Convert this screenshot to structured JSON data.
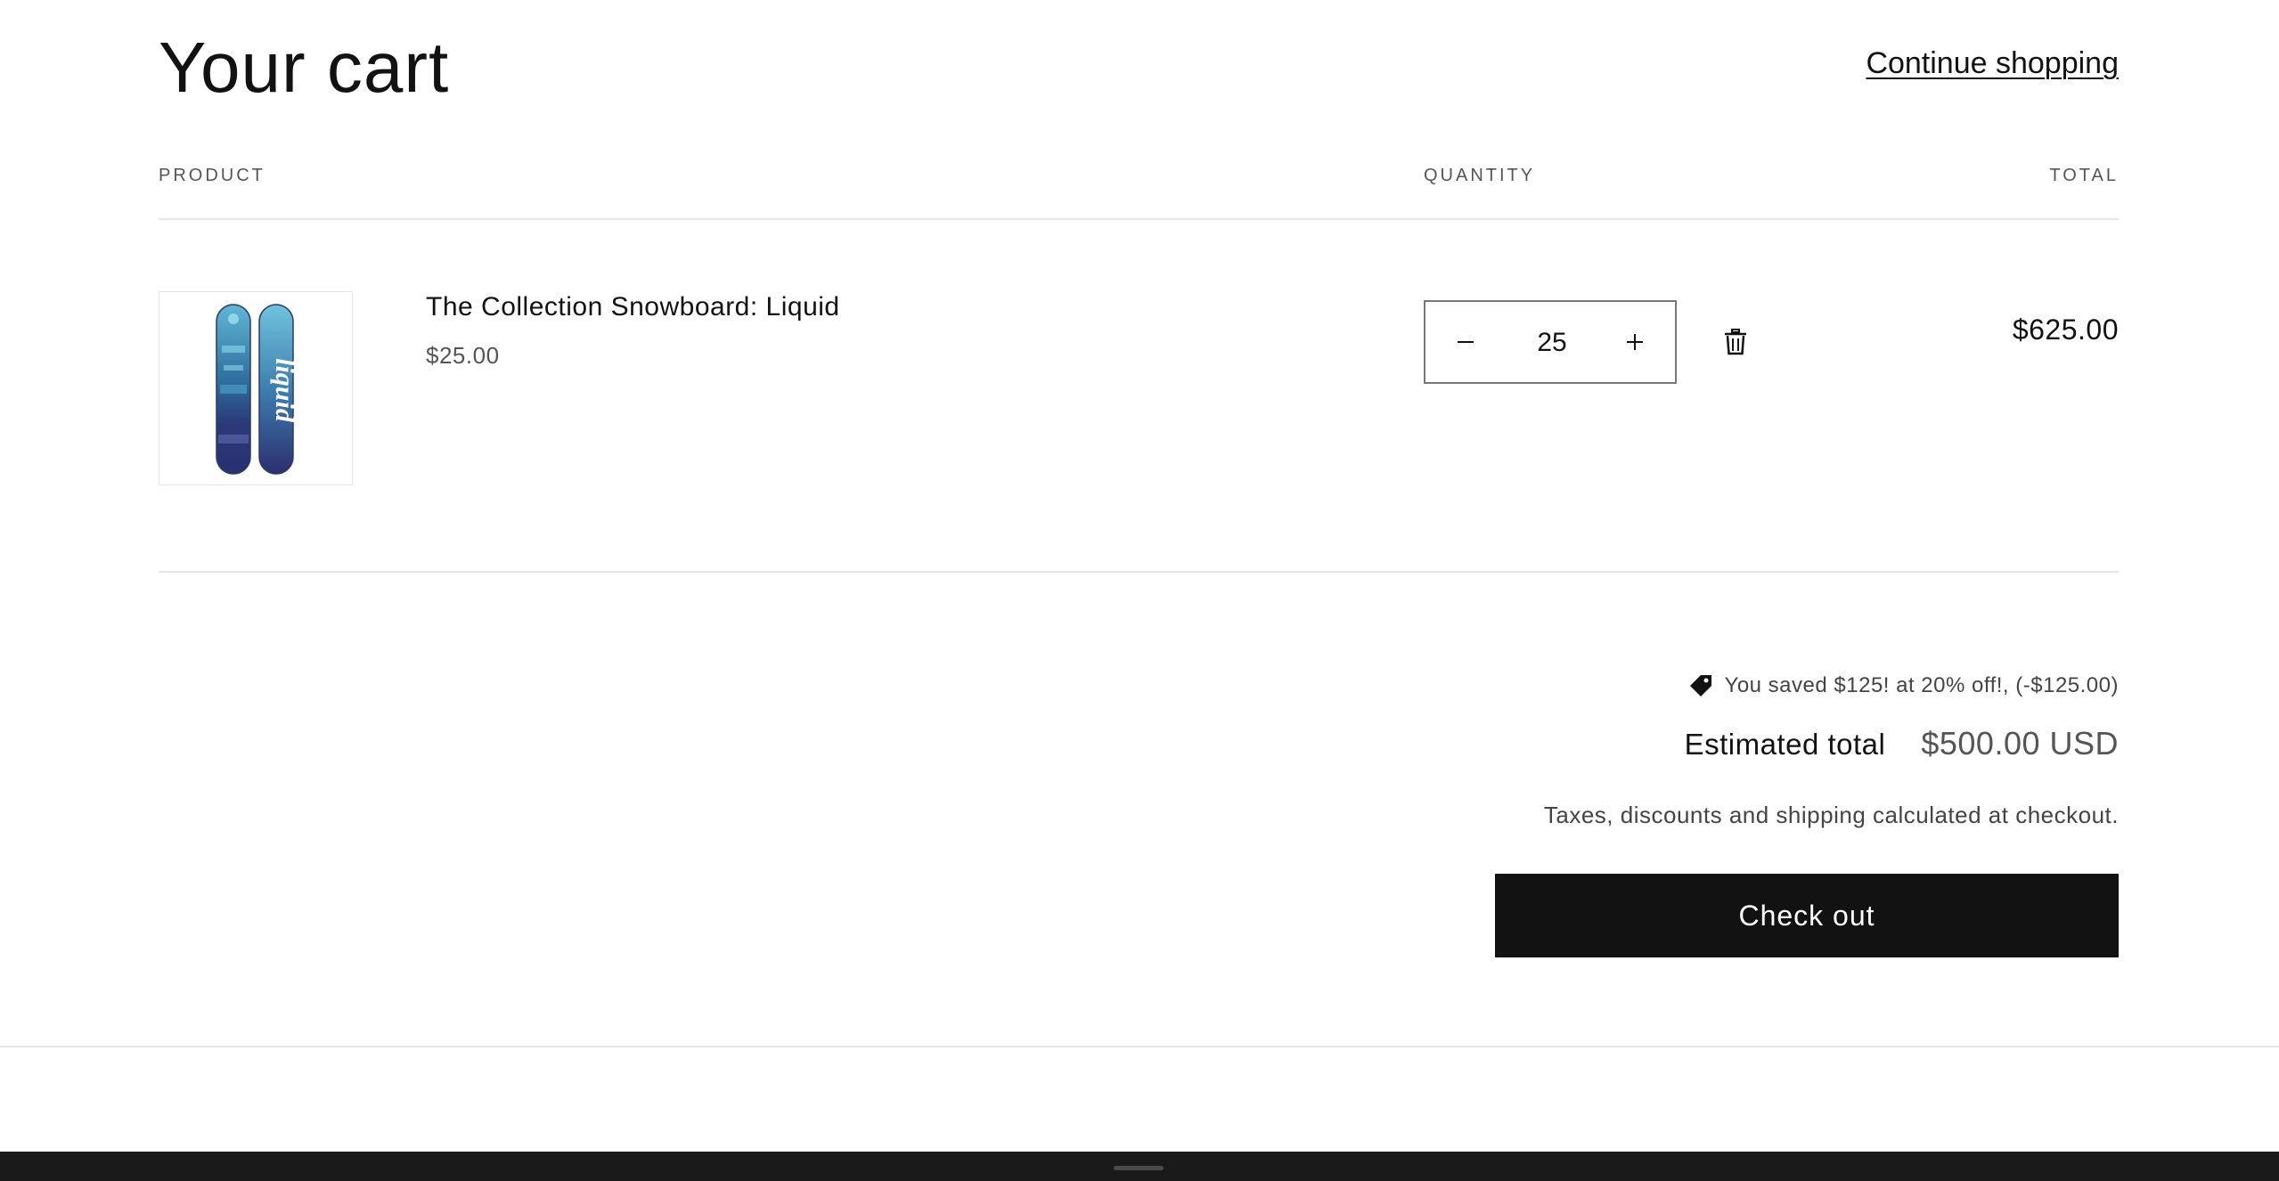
{
  "header": {
    "title": "Your cart",
    "continue_label": "Continue shopping"
  },
  "columns": {
    "product": "PRODUCT",
    "quantity": "QUANTITY",
    "total": "TOTAL"
  },
  "items": [
    {
      "name": "The Collection Snowboard: Liquid",
      "unit_price": "$25.00",
      "quantity": "25",
      "line_total": "$625.00",
      "image_icon": "snowboard-liquid-thumbnail"
    }
  ],
  "controls": {
    "minus_symbol": "−",
    "plus_symbol": "+",
    "remove_icon": "trash-icon"
  },
  "summary": {
    "discount_icon": "tag-icon",
    "discount_text": "You saved $125! at 20% off!, (-$125.00)",
    "estimated_label": "Estimated total",
    "estimated_value": "$500.00 USD",
    "tax_note": "Taxes, discounts and shipping calculated at checkout.",
    "checkout_label": "Check out"
  },
  "colors": {
    "primary": "#121212",
    "muted": "#555555",
    "border": "#e6e6e6",
    "footer": "#1a1a1a"
  }
}
